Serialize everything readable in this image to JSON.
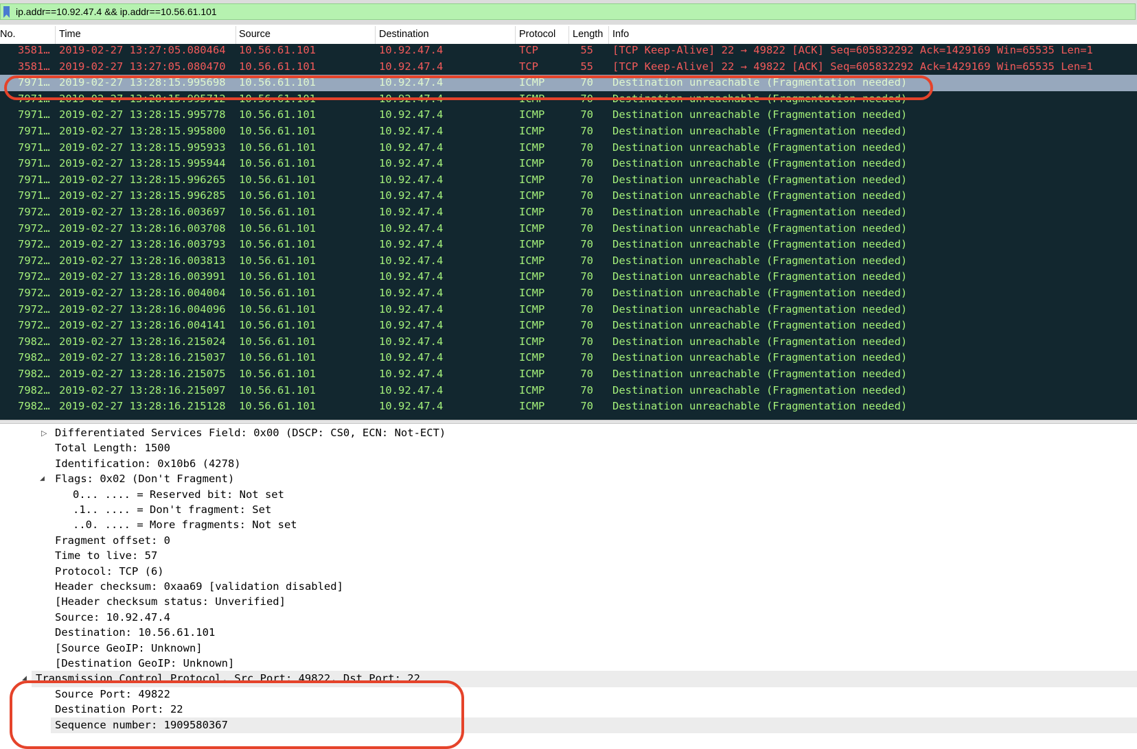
{
  "filter": {
    "text": "ip.addr==10.92.47.4 && ip.addr==10.56.61.101"
  },
  "columns": {
    "no": "No.",
    "time": "Time",
    "source": "Source",
    "destination": "Destination",
    "protocol": "Protocol",
    "length": "Length",
    "info": "Info"
  },
  "packets": [
    {
      "no": "3581…",
      "time": "2019-02-27 13:27:05.080464",
      "src": "10.56.61.101",
      "dst": "10.92.47.4",
      "proto": "TCP",
      "len": "55",
      "info": "[TCP Keep-Alive] 22 → 49822 [ACK] Seq=605832292 Ack=1429169 Win=65535 Len=1",
      "kind": "tcp"
    },
    {
      "no": "3581…",
      "time": "2019-02-27 13:27:05.080470",
      "src": "10.56.61.101",
      "dst": "10.92.47.4",
      "proto": "TCP",
      "len": "55",
      "info": "[TCP Keep-Alive] 22 → 49822 [ACK] Seq=605832292 Ack=1429169 Win=65535 Len=1",
      "kind": "tcp"
    },
    {
      "no": "7971…",
      "time": "2019-02-27 13:28:15.995698",
      "src": "10.56.61.101",
      "dst": "10.92.47.4",
      "proto": "ICMP",
      "len": "70",
      "info": "Destination unreachable (Fragmentation needed)",
      "kind": "icmp",
      "selected": true
    },
    {
      "no": "7971…",
      "time": "2019-02-27 13:28:15.995712",
      "src": "10.56.61.101",
      "dst": "10.92.47.4",
      "proto": "ICMP",
      "len": "70",
      "info": "Destination unreachable (Fragmentation needed)",
      "kind": "icmp"
    },
    {
      "no": "7971…",
      "time": "2019-02-27 13:28:15.995778",
      "src": "10.56.61.101",
      "dst": "10.92.47.4",
      "proto": "ICMP",
      "len": "70",
      "info": "Destination unreachable (Fragmentation needed)",
      "kind": "icmp"
    },
    {
      "no": "7971…",
      "time": "2019-02-27 13:28:15.995800",
      "src": "10.56.61.101",
      "dst": "10.92.47.4",
      "proto": "ICMP",
      "len": "70",
      "info": "Destination unreachable (Fragmentation needed)",
      "kind": "icmp"
    },
    {
      "no": "7971…",
      "time": "2019-02-27 13:28:15.995933",
      "src": "10.56.61.101",
      "dst": "10.92.47.4",
      "proto": "ICMP",
      "len": "70",
      "info": "Destination unreachable (Fragmentation needed)",
      "kind": "icmp"
    },
    {
      "no": "7971…",
      "time": "2019-02-27 13:28:15.995944",
      "src": "10.56.61.101",
      "dst": "10.92.47.4",
      "proto": "ICMP",
      "len": "70",
      "info": "Destination unreachable (Fragmentation needed)",
      "kind": "icmp"
    },
    {
      "no": "7971…",
      "time": "2019-02-27 13:28:15.996265",
      "src": "10.56.61.101",
      "dst": "10.92.47.4",
      "proto": "ICMP",
      "len": "70",
      "info": "Destination unreachable (Fragmentation needed)",
      "kind": "icmp"
    },
    {
      "no": "7971…",
      "time": "2019-02-27 13:28:15.996285",
      "src": "10.56.61.101",
      "dst": "10.92.47.4",
      "proto": "ICMP",
      "len": "70",
      "info": "Destination unreachable (Fragmentation needed)",
      "kind": "icmp"
    },
    {
      "no": "7972…",
      "time": "2019-02-27 13:28:16.003697",
      "src": "10.56.61.101",
      "dst": "10.92.47.4",
      "proto": "ICMP",
      "len": "70",
      "info": "Destination unreachable (Fragmentation needed)",
      "kind": "icmp"
    },
    {
      "no": "7972…",
      "time": "2019-02-27 13:28:16.003708",
      "src": "10.56.61.101",
      "dst": "10.92.47.4",
      "proto": "ICMP",
      "len": "70",
      "info": "Destination unreachable (Fragmentation needed)",
      "kind": "icmp"
    },
    {
      "no": "7972…",
      "time": "2019-02-27 13:28:16.003793",
      "src": "10.56.61.101",
      "dst": "10.92.47.4",
      "proto": "ICMP",
      "len": "70",
      "info": "Destination unreachable (Fragmentation needed)",
      "kind": "icmp"
    },
    {
      "no": "7972…",
      "time": "2019-02-27 13:28:16.003813",
      "src": "10.56.61.101",
      "dst": "10.92.47.4",
      "proto": "ICMP",
      "len": "70",
      "info": "Destination unreachable (Fragmentation needed)",
      "kind": "icmp"
    },
    {
      "no": "7972…",
      "time": "2019-02-27 13:28:16.003991",
      "src": "10.56.61.101",
      "dst": "10.92.47.4",
      "proto": "ICMP",
      "len": "70",
      "info": "Destination unreachable (Fragmentation needed)",
      "kind": "icmp"
    },
    {
      "no": "7972…",
      "time": "2019-02-27 13:28:16.004004",
      "src": "10.56.61.101",
      "dst": "10.92.47.4",
      "proto": "ICMP",
      "len": "70",
      "info": "Destination unreachable (Fragmentation needed)",
      "kind": "icmp"
    },
    {
      "no": "7972…",
      "time": "2019-02-27 13:28:16.004096",
      "src": "10.56.61.101",
      "dst": "10.92.47.4",
      "proto": "ICMP",
      "len": "70",
      "info": "Destination unreachable (Fragmentation needed)",
      "kind": "icmp"
    },
    {
      "no": "7972…",
      "time": "2019-02-27 13:28:16.004141",
      "src": "10.56.61.101",
      "dst": "10.92.47.4",
      "proto": "ICMP",
      "len": "70",
      "info": "Destination unreachable (Fragmentation needed)",
      "kind": "icmp"
    },
    {
      "no": "7982…",
      "time": "2019-02-27 13:28:16.215024",
      "src": "10.56.61.101",
      "dst": "10.92.47.4",
      "proto": "ICMP",
      "len": "70",
      "info": "Destination unreachable (Fragmentation needed)",
      "kind": "icmp"
    },
    {
      "no": "7982…",
      "time": "2019-02-27 13:28:16.215037",
      "src": "10.56.61.101",
      "dst": "10.92.47.4",
      "proto": "ICMP",
      "len": "70",
      "info": "Destination unreachable (Fragmentation needed)",
      "kind": "icmp"
    },
    {
      "no": "7982…",
      "time": "2019-02-27 13:28:16.215075",
      "src": "10.56.61.101",
      "dst": "10.92.47.4",
      "proto": "ICMP",
      "len": "70",
      "info": "Destination unreachable (Fragmentation needed)",
      "kind": "icmp"
    },
    {
      "no": "7982…",
      "time": "2019-02-27 13:28:16.215097",
      "src": "10.56.61.101",
      "dst": "10.92.47.4",
      "proto": "ICMP",
      "len": "70",
      "info": "Destination unreachable (Fragmentation needed)",
      "kind": "icmp"
    },
    {
      "no": "7982…",
      "time": "2019-02-27 13:28:16.215128",
      "src": "10.56.61.101",
      "dst": "10.92.47.4",
      "proto": "ICMP",
      "len": "70",
      "info": "Destination unreachable (Fragmentation needed)",
      "kind": "icmp"
    }
  ],
  "details": [
    {
      "text": "Differentiated Services Field: 0x00 (DSCP: CS0, ECN: Not-ECT)",
      "toggle": "collapsed"
    },
    {
      "text": "Total Length: 1500"
    },
    {
      "text": "Identification: 0x10b6 (4278)"
    },
    {
      "text": "Flags: 0x02 (Don't Fragment)",
      "toggle": "expanded"
    },
    {
      "text": "0... .... = Reserved bit: Not set",
      "sub": true
    },
    {
      "text": ".1.. .... = Don't fragment: Set",
      "sub": true
    },
    {
      "text": "..0. .... = More fragments: Not set",
      "sub": true
    },
    {
      "text": "Fragment offset: 0"
    },
    {
      "text": "Time to live: 57"
    },
    {
      "text": "Protocol: TCP (6)"
    },
    {
      "text": "Header checksum: 0xaa69 [validation disabled]"
    },
    {
      "text": "[Header checksum status: Unverified]"
    },
    {
      "text": "Source: 10.92.47.4"
    },
    {
      "text": "Destination: 10.56.61.101"
    },
    {
      "text": "[Source GeoIP: Unknown]"
    },
    {
      "text": "[Destination GeoIP: Unknown]"
    },
    {
      "text": "Transmission Control Protocol, Src Port: 49822, Dst Port: 22",
      "toggle": "expanded",
      "top": true,
      "shaded": true
    },
    {
      "text": "Source Port: 49822"
    },
    {
      "text": "Destination Port: 22"
    },
    {
      "text": "Sequence number: 1909580367",
      "shaded": true
    }
  ],
  "icons": {
    "filter_bookmark": "bookmark-icon",
    "collapsed": "triangle-right-icon",
    "expanded": "triangle-down-icon"
  },
  "colors": {
    "list_background": "#12272f",
    "tcp_text": "#f25a5a",
    "icmp_text": "#a4f07a",
    "selected_row": "#97a8bd",
    "filter_background": "#b6f2b0",
    "annotation": "#e5432a"
  }
}
